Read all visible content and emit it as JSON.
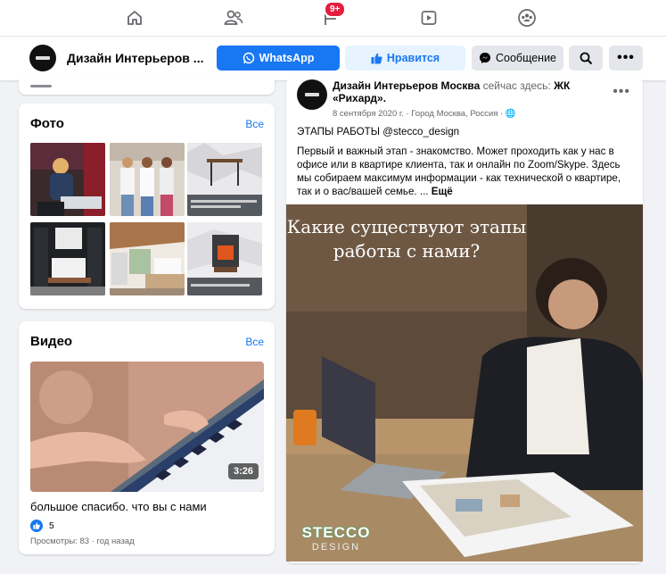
{
  "nav": {
    "badge": "9+",
    "icons": [
      "home-icon",
      "friends-icon",
      "flag-icon",
      "watch-icon",
      "groups-icon"
    ]
  },
  "page_header": {
    "name": "Дизайн Интерьеров ...",
    "whatsapp_label": "WhatsApp",
    "like_label": "Нравится",
    "message_label": "Сообщение",
    "colors": {
      "accent": "#1877f2",
      "like_bg": "#e7f3ff",
      "gray_btn": "#e4e6eb"
    }
  },
  "photos": {
    "title": "Фото",
    "see_all": "Все"
  },
  "videos": {
    "title": "Видео",
    "see_all": "Все",
    "duration": "3:26",
    "video_title": "большое спасибо. что вы с нами",
    "reactions": "5",
    "meta": "Просмотры: 83 · год назад"
  },
  "post": {
    "author": "Дизайн Интерьеров Москва",
    "location_prefix": " сейчас здесь: ",
    "location": "ЖК «Рихард».",
    "date": "8 сентября 2020 г.",
    "place": " · Город Москва, Россия · ",
    "tagline": "ЭТАПЫ РАБОТЫ  @stecco_design",
    "body": "Первый и важный этап - знакомство. Может проходить как у нас в офисе или в квартире клиента, так и онлайн по Zoom/Skype. Здесь мы собираем максимум информации - как технической о квартире, так и о вас/вашей семье. ... ",
    "more": "Ещё",
    "image_headline_1": "Какие существуют этапы",
    "image_headline_2": "работы с нами?",
    "brand_1": "STECCO",
    "brand_2": "DESIGN"
  }
}
